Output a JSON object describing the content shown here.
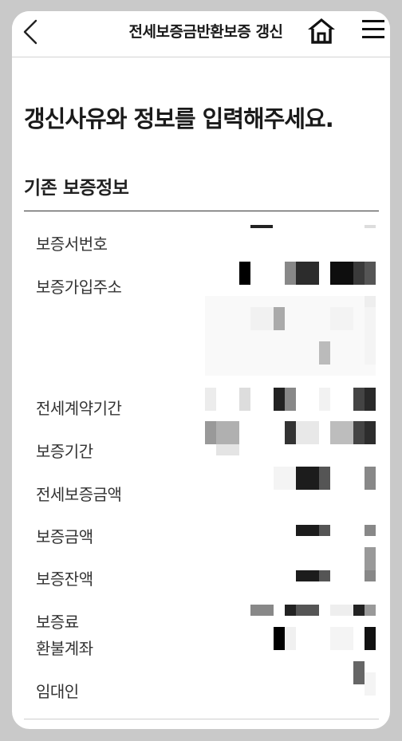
{
  "header": {
    "title": "전세보증금반환보증 갱신",
    "back_icon": "chevron-left-icon",
    "home_icon": "home-icon",
    "menu_icon": "hamburger-menu-icon"
  },
  "main": {
    "headline": "갱신사유와 정보를 입력해주세요.",
    "section_title": "기존 보증정보",
    "rows": [
      {
        "label": "보증서번호"
      },
      {
        "label": "보증가입주소"
      },
      {
        "label": "전세계약기간"
      },
      {
        "label": "보증기간"
      },
      {
        "label": "전세보증금액"
      },
      {
        "label": "보증금액"
      },
      {
        "label": "보증잔액"
      },
      {
        "label": "보증료"
      },
      {
        "label": "환불계좌"
      },
      {
        "label": "임대인"
      }
    ]
  },
  "colors": {
    "background": "#c9c9c9",
    "screen": "#ffffff",
    "text": "#1a1a1a",
    "label": "#333333"
  }
}
